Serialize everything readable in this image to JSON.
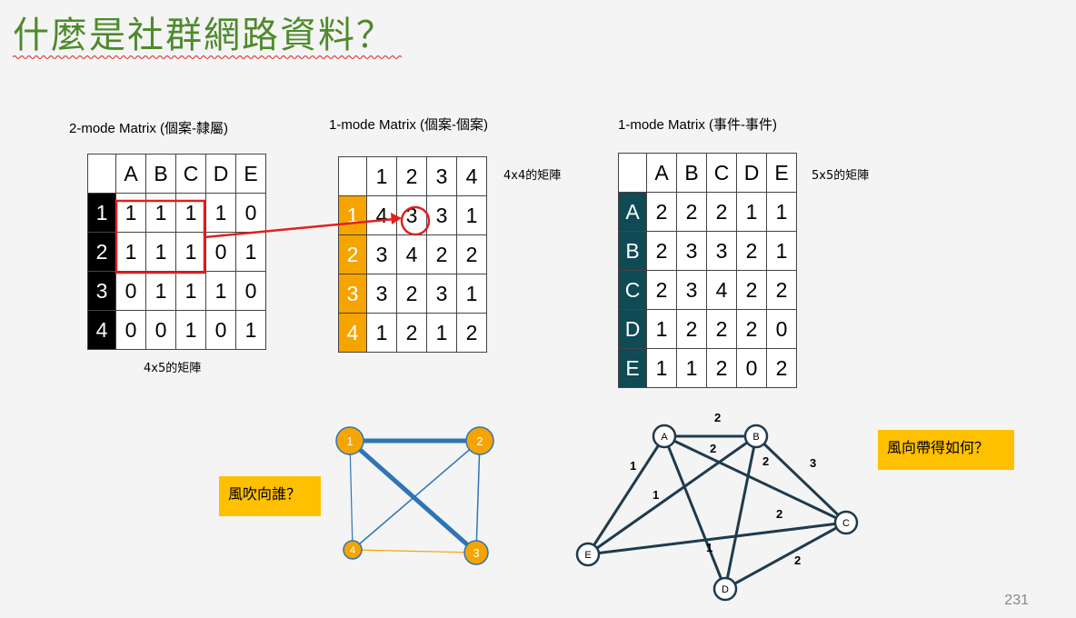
{
  "slide": {
    "title": "什麼是社群網路資料？",
    "page_number": "231"
  },
  "matrix2mode": {
    "caption": "2-mode Matrix (個案-隸屬)",
    "size_note": "4x5的矩陣",
    "cols": [
      "A",
      "B",
      "C",
      "D",
      "E"
    ],
    "rows": [
      {
        "label": "1",
        "values": [
          "1",
          "1",
          "1",
          "1",
          "0"
        ]
      },
      {
        "label": "2",
        "values": [
          "1",
          "1",
          "1",
          "0",
          "1"
        ]
      },
      {
        "label": "3",
        "values": [
          "0",
          "1",
          "1",
          "1",
          "0"
        ]
      },
      {
        "label": "4",
        "values": [
          "0",
          "0",
          "1",
          "0",
          "1"
        ]
      }
    ]
  },
  "matrix1mode_cases": {
    "caption": "1-mode Matrix (個案-個案)",
    "size_note": "4x4的矩陣",
    "cols": [
      "1",
      "2",
      "3",
      "4"
    ],
    "rows": [
      {
        "label": "1",
        "values": [
          "4",
          "3",
          "3",
          "1"
        ]
      },
      {
        "label": "2",
        "values": [
          "3",
          "4",
          "2",
          "2"
        ]
      },
      {
        "label": "3",
        "values": [
          "3",
          "2",
          "3",
          "1"
        ]
      },
      {
        "label": "4",
        "values": [
          "1",
          "2",
          "1",
          "2"
        ]
      }
    ]
  },
  "matrix1mode_events": {
    "caption": "1-mode Matrix (事件-事件)",
    "size_note": "5x5的矩陣",
    "cols": [
      "A",
      "B",
      "C",
      "D",
      "E"
    ],
    "rows": [
      {
        "label": "A",
        "values": [
          "2",
          "2",
          "2",
          "1",
          "1"
        ]
      },
      {
        "label": "B",
        "values": [
          "2",
          "3",
          "3",
          "2",
          "1"
        ]
      },
      {
        "label": "C",
        "values": [
          "2",
          "3",
          "4",
          "2",
          "2"
        ]
      },
      {
        "label": "D",
        "values": [
          "1",
          "2",
          "2",
          "2",
          "0"
        ]
      },
      {
        "label": "E",
        "values": [
          "1",
          "1",
          "2",
          "0",
          "2"
        ]
      }
    ]
  },
  "network_cases": {
    "question": "風吹向誰？",
    "nodes": [
      "1",
      "2",
      "3",
      "4"
    ],
    "node_color": "#f5a400",
    "edge_color": "#2e75b6",
    "edge_color_alt": "#f5a400"
  },
  "network_events": {
    "question": "風向帶得如何？",
    "nodes": [
      "A",
      "B",
      "C",
      "D",
      "E"
    ],
    "edge_color": "#1f3b4d",
    "edge_labels": [
      "2",
      "2",
      "1",
      "2",
      "3",
      "1",
      "2",
      "1",
      "2"
    ]
  },
  "colors": {
    "title": "#4e8a2c",
    "highlight_red": "#e02020",
    "box_yellow": "#ffc000"
  }
}
